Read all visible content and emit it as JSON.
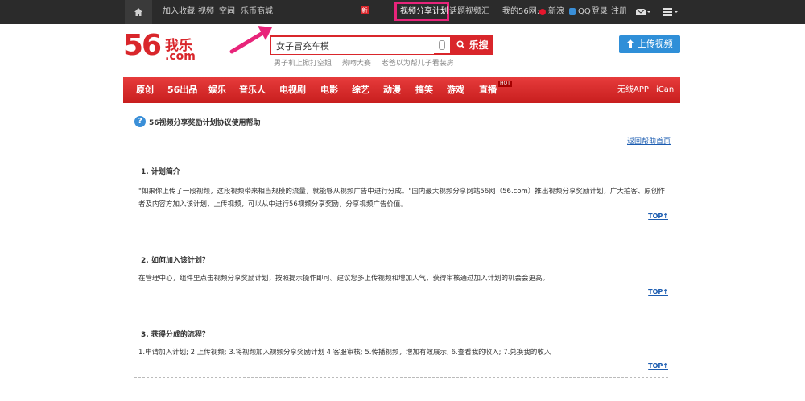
{
  "topbar": {
    "items": [
      "加入收藏",
      "视频",
      "空间",
      "乐币商城",
      "视频分享计划",
      "话题视频汇"
    ],
    "new_badge": "新",
    "my56": "我的56网:",
    "weibo": "新浪",
    "qq": "QQ",
    "login": "登录",
    "register": "注册"
  },
  "logo": {
    "num": "56",
    "cn": "我乐",
    "com": ".com"
  },
  "search": {
    "value": "女子冒充车模",
    "button": "乐搜",
    "hot": [
      "男子机上掀打空姐",
      "热吻大赛",
      "老爸以为帮儿子看装房"
    ]
  },
  "upload": "上传视频",
  "nav": {
    "items": [
      "原创",
      "56出品",
      "娱乐",
      "音乐人",
      "电视剧",
      "电影",
      "综艺",
      "动漫",
      "搞笑",
      "游戏",
      "直播"
    ],
    "hot_tag": "HOT",
    "right": [
      "无线APP",
      "iCan"
    ]
  },
  "help": {
    "title": "56视频分享奖励计划协议使用帮助",
    "back": "返回帮助首页"
  },
  "sections": [
    {
      "head": "1. 计划简介",
      "body": "\"如果你上传了一段视频，这段视频带来相当规模的流量，就能够从视频广告中进行分成。\"国内最大视频分享网站56网（56.com）推出视频分享奖励计划，广大拍客、原创作者及内容方加入该计划，上传视频，可以从中进行56视频分享奖励，分享视频广告价值。",
      "top": "TOP↑"
    },
    {
      "head": "2. 如何加入该计划？",
      "body": "在管理中心，组件里点击视频分享奖励计划，按照提示操作即可。建议您多上传视频和增加人气，获得审核通过加入计划的机会会更高。",
      "top": "TOP↑"
    },
    {
      "head": "3. 获得分成的流程？",
      "body": "1.申请加入计划; 2.上传视频; 3.将视频加入视频分享奖励计划 4.客服审核; 5.传播视频，增加有效展示; 6.查看我的收入; 7.兑换我的收入",
      "top": "TOP↑"
    }
  ],
  "colors": {
    "brand": "#d9262b",
    "link": "#1a5bb0",
    "highlight": "#e8247a",
    "upload": "#2f8fd8"
  }
}
